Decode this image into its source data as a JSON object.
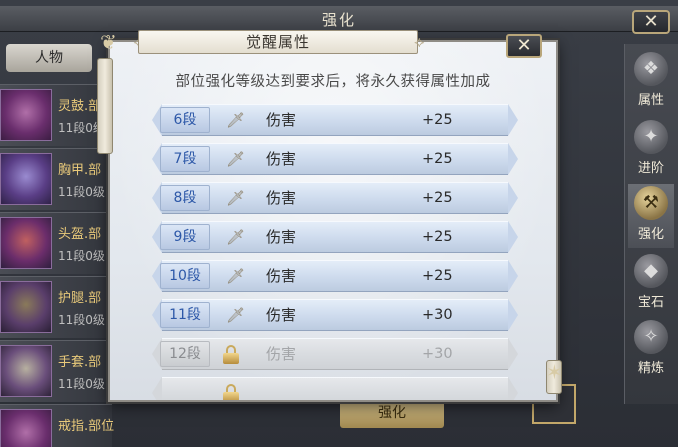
{
  "background": {
    "title": "强化",
    "close_label": "✕",
    "tab_label": "人物",
    "items": [
      {
        "name": "灵鼓.部",
        "level": "11段0级"
      },
      {
        "name": "胸甲.部",
        "level": "11段0级"
      },
      {
        "name": "头盔.部",
        "level": "11段0级"
      },
      {
        "name": "护腿.部",
        "level": "11段0级"
      },
      {
        "name": "手套.部",
        "level": "11段0级"
      },
      {
        "name": "戒指.部位",
        "level": ""
      }
    ],
    "side_tabs": [
      {
        "label": "属性",
        "icon": "attribute-icon"
      },
      {
        "label": "进阶",
        "icon": "advance-icon"
      },
      {
        "label": "强化",
        "icon": "enhance-icon"
      },
      {
        "label": "宝石",
        "icon": "gem-icon"
      },
      {
        "label": "精炼",
        "icon": "refine-icon"
      }
    ],
    "bottom_button": "强化"
  },
  "modal": {
    "title": "觉醒属性",
    "close_label": "✕",
    "description": "部位强化等级达到要求后，将永久获得属性加成",
    "rows": [
      {
        "tier": "6段",
        "attr": "伤害",
        "value": "+25",
        "locked": false
      },
      {
        "tier": "7段",
        "attr": "伤害",
        "value": "+25",
        "locked": false
      },
      {
        "tier": "8段",
        "attr": "伤害",
        "value": "+25",
        "locked": false
      },
      {
        "tier": "9段",
        "attr": "伤害",
        "value": "+25",
        "locked": false
      },
      {
        "tier": "10段",
        "attr": "伤害",
        "value": "+25",
        "locked": false
      },
      {
        "tier": "11段",
        "attr": "伤害",
        "value": "+30",
        "locked": false
      },
      {
        "tier": "12段",
        "attr": "伤害",
        "value": "+30",
        "locked": true
      }
    ]
  },
  "colors": {
    "tier_text": "#2d58a8",
    "bar_blue": "#cfdcee",
    "locked_gray": "#a3a5a8",
    "gold": "#c9a95c"
  }
}
